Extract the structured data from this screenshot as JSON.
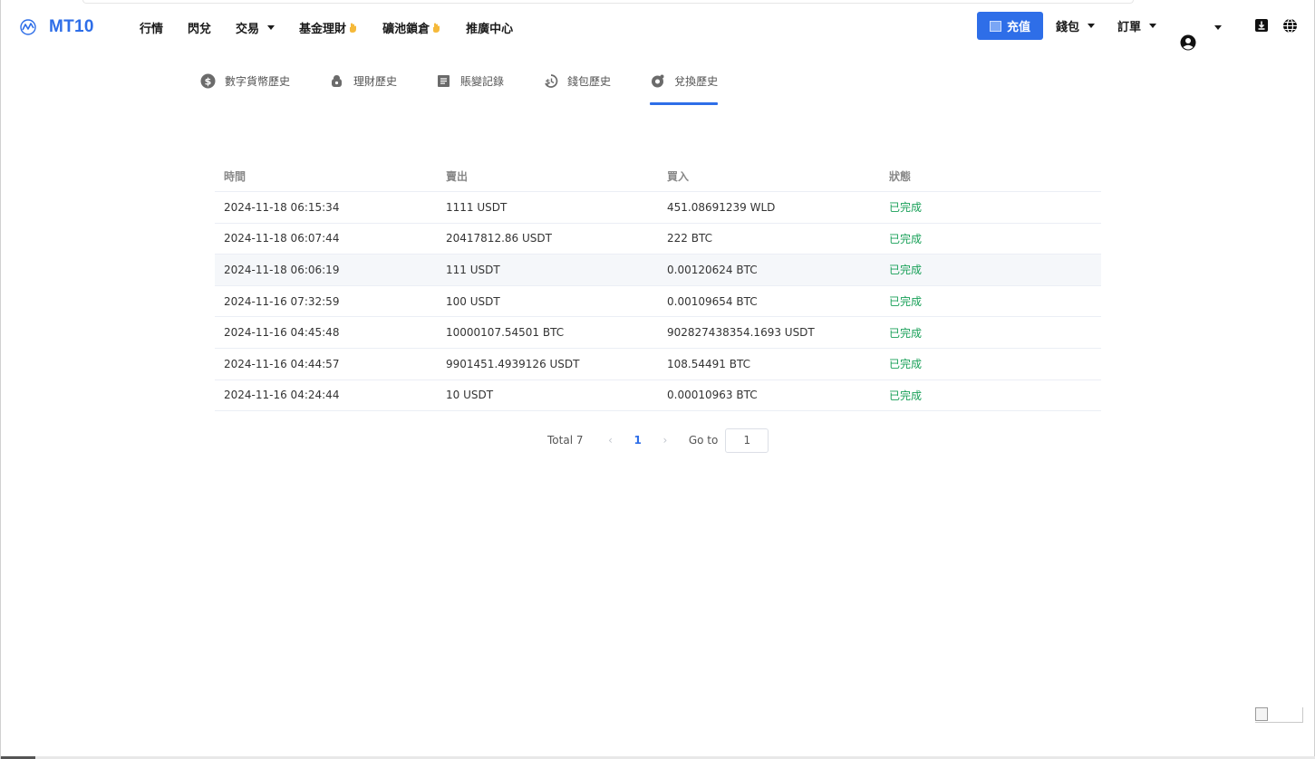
{
  "brand": {
    "name": "MT10",
    "accent": "#2e6ee8"
  },
  "nav": {
    "items": [
      {
        "label": "行情"
      },
      {
        "label": "閃兌"
      },
      {
        "label": "交易"
      },
      {
        "label": "基金理財"
      },
      {
        "label": "礦池鎖倉"
      },
      {
        "label": "推廣中心"
      }
    ]
  },
  "header_right": {
    "deposit_label": "充值",
    "wallet_label": "錢包",
    "orders_label": "訂單"
  },
  "tabs": [
    {
      "label": "數字貨幣歷史",
      "icon": "dollar-circle-icon"
    },
    {
      "label": "理財歷史",
      "icon": "piggy-bank-icon"
    },
    {
      "label": "賬變記錄",
      "icon": "document-icon"
    },
    {
      "label": "錢包歷史",
      "icon": "wallet-history-icon"
    },
    {
      "label": "兌換歷史",
      "icon": "exchange-icon",
      "active": true
    }
  ],
  "table": {
    "headers": {
      "time": "時間",
      "sell": "賣出",
      "buy": "買入",
      "status": "狀態"
    },
    "rows": [
      {
        "time": "2024-11-18 06:15:34",
        "sell": "1111 USDT",
        "buy": "451.08691239 WLD",
        "status": "已完成"
      },
      {
        "time": "2024-11-18 06:07:44",
        "sell": "20417812.86 USDT",
        "buy": "222 BTC",
        "status": "已完成"
      },
      {
        "time": "2024-11-18 06:06:19",
        "sell": "111 USDT",
        "buy": "0.00120624 BTC",
        "status": "已完成"
      },
      {
        "time": "2024-11-16 07:32:59",
        "sell": "100 USDT",
        "buy": "0.00109654 BTC",
        "status": "已完成"
      },
      {
        "time": "2024-11-16 04:45:48",
        "sell": "10000107.54501 BTC",
        "buy": "902827438354.1693 USDT",
        "status": "已完成"
      },
      {
        "time": "2024-11-16 04:44:57",
        "sell": "9901451.4939126 USDT",
        "buy": "108.54491 BTC",
        "status": "已完成"
      },
      {
        "time": "2024-11-16 04:24:44",
        "sell": "10 USDT",
        "buy": "0.00010963 BTC",
        "status": "已完成"
      }
    ]
  },
  "pagination": {
    "total_label": "Total 7",
    "current_page": "1",
    "goto_label": "Go to",
    "goto_value": "1"
  },
  "colors": {
    "status_done": "#18a058",
    "primary": "#2e6ee8"
  }
}
